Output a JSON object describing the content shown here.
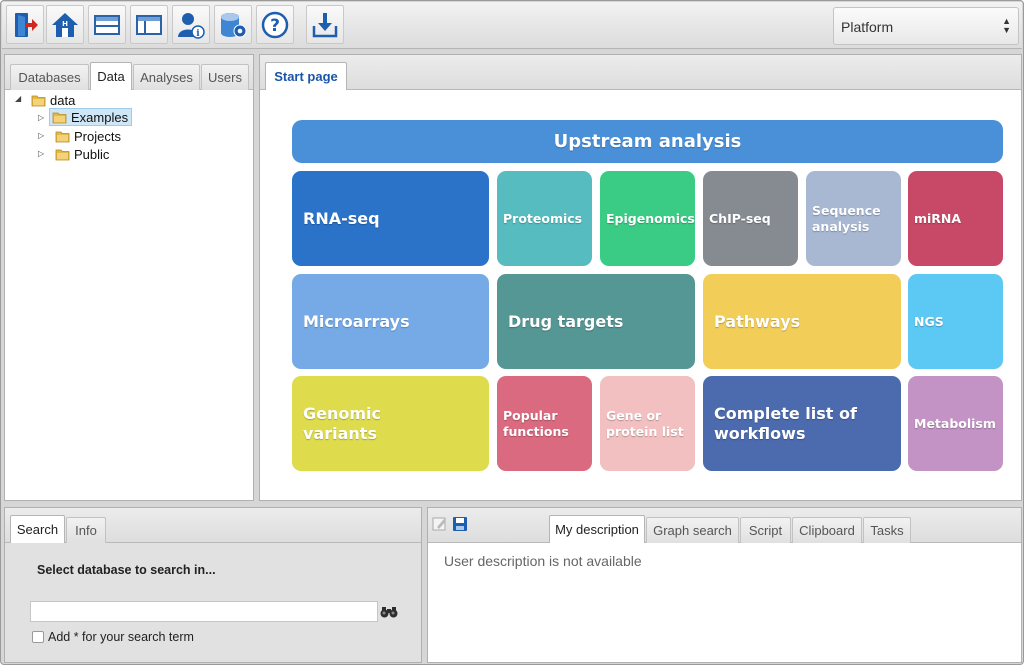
{
  "toolbar": {
    "buttons": [
      {
        "icon": "exit-icon"
      },
      {
        "icon": "home-icon"
      },
      {
        "icon": "layout-horizontal-icon"
      },
      {
        "icon": "layout-vertical-icon"
      },
      {
        "icon": "user-info-icon"
      },
      {
        "icon": "database-settings-icon"
      },
      {
        "icon": "help-icon"
      },
      {
        "icon": "download-icon"
      }
    ],
    "platform_select": "Platform"
  },
  "left_panel": {
    "tabs": [
      "Databases",
      "Data",
      "Analyses",
      "Users"
    ],
    "active_tab": "Data",
    "tree": {
      "root": "data",
      "children": [
        "Examples",
        "Projects",
        "Public"
      ],
      "selected": "Examples"
    }
  },
  "main": {
    "tabs": [
      "Start page"
    ],
    "header_tile": "Upstream analysis",
    "tiles": [
      {
        "label": "RNA-seq",
        "color": "#2b72c9"
      },
      {
        "label": "Proteomics",
        "color": "#57bcc0"
      },
      {
        "label": "Epigenomics",
        "color": "#3acb84"
      },
      {
        "label": "ChIP-seq",
        "color": "#868b91"
      },
      {
        "label": "Sequence analysis",
        "color": "#a8b8d3"
      },
      {
        "label": "miRNA",
        "color": "#c84867"
      },
      {
        "label": "Microarrays",
        "color": "#76aae6"
      },
      {
        "label": "Drug targets",
        "color": "#549795"
      },
      {
        "label": "Pathways",
        "color": "#f2cd57"
      },
      {
        "label": "NGS",
        "color": "#5cc8f4"
      },
      {
        "label": "Genomic variants",
        "color": "#dedc4d"
      },
      {
        "label": "Popular functions",
        "color": "#d96a7f"
      },
      {
        "label": "Gene or protein list",
        "color": "#f2c0c0"
      },
      {
        "label": "Complete list of workflows",
        "color": "#4c6bae"
      },
      {
        "label": "Metabolism",
        "color": "#c293c4"
      }
    ],
    "header_color": "#4a90d9"
  },
  "search_panel": {
    "tabs": [
      "Search",
      "Info"
    ],
    "active_tab": "Search",
    "heading": "Select database to search in...",
    "input_value": "",
    "checkbox_label": "Add * for your search term"
  },
  "bottom_panel": {
    "tabs": [
      "My description",
      "Graph search",
      "Script",
      "Clipboard",
      "Tasks"
    ],
    "active_tab": "My description",
    "message": "User description is not available"
  }
}
